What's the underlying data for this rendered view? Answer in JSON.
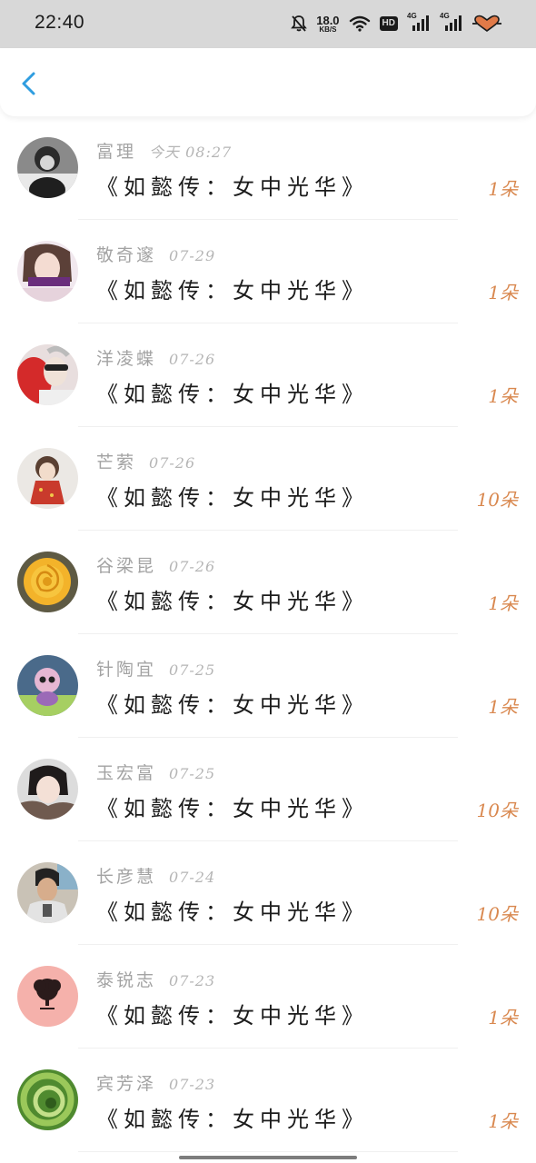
{
  "status_bar": {
    "time": "22:40",
    "net_speed": "18.0",
    "net_speed_unit": "KB/S",
    "hd_label": "HD",
    "network_1": "4G",
    "network_2": "4G"
  },
  "header": {
    "back_icon": "chevron-left-icon",
    "accent": "#2f9de0"
  },
  "gift_list": [
    {
      "user": "富理",
      "date": "今天 08:27",
      "title": "《如懿传：女中光华》",
      "count": "1朵",
      "avatar": "grayscale-photo"
    },
    {
      "user": "敬奇邃",
      "date": "07-29",
      "title": "《如懿传：女中光华》",
      "count": "1朵",
      "avatar": "girl-photo"
    },
    {
      "user": "洋凌蝶",
      "date": "07-26",
      "title": "《如懿传：女中光华》",
      "count": "1朵",
      "avatar": "sunglasses-photo"
    },
    {
      "user": "芒萦",
      "date": "07-26",
      "title": "《如懿传：女中光华》",
      "count": "10朵",
      "avatar": "doll-photo"
    },
    {
      "user": "谷梁昆",
      "date": "07-26",
      "title": "《如懿传：女中光华》",
      "count": "1朵",
      "avatar": "yellow-rose"
    },
    {
      "user": "针陶宜",
      "date": "07-25",
      "title": "《如懿传：女中光华》",
      "count": "1朵",
      "avatar": "toy-figure"
    },
    {
      "user": "玉宏富",
      "date": "07-25",
      "title": "《如懿传：女中光华》",
      "count": "10朵",
      "avatar": "selfie-photo"
    },
    {
      "user": "长彦慧",
      "date": "07-24",
      "title": "《如懿传：女中光华》",
      "count": "10朵",
      "avatar": "man-photo"
    },
    {
      "user": "泰锐志",
      "date": "07-23",
      "title": "《如懿传：女中光华》",
      "count": "1朵",
      "avatar": "tree-logo"
    },
    {
      "user": "宾芳泽",
      "date": "07-23",
      "title": "《如懿传：女中光华》",
      "count": "1朵",
      "avatar": "green-swirl"
    }
  ],
  "colors": {
    "name": "#a3a3a3",
    "title": "#1c1c1c",
    "count": "#d9884f"
  }
}
